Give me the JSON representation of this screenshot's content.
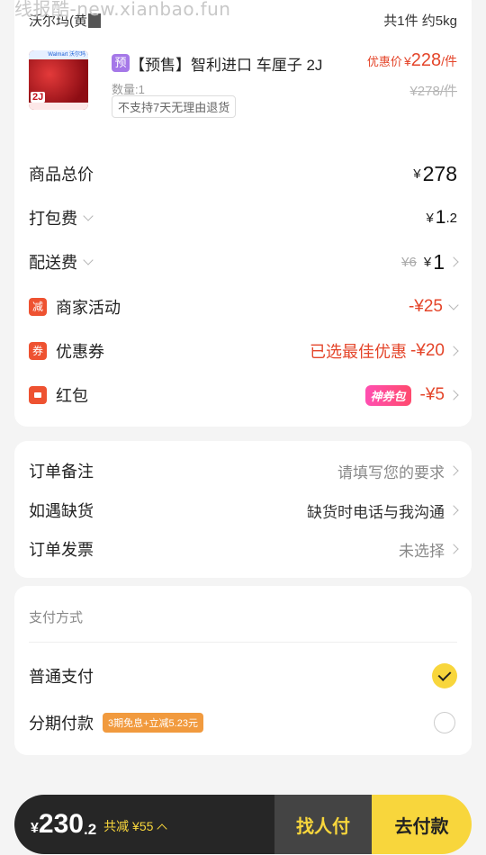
{
  "watermark": "线报酷-new.xianbao.fun",
  "store": {
    "name": "沃尔玛(黄",
    "summary": "共1件 约5kg"
  },
  "product": {
    "thumb_brand": "Walmart 沃尔玛",
    "thumb_badge": "2J",
    "pre_badge": "预",
    "title": "【预售】智利进口 车厘子 2J",
    "qty": "数量:1",
    "return_note": "不支持7天无理由退货",
    "price_label": "优惠价",
    "currency": "¥",
    "price": "228",
    "unit": "/件",
    "original_price": "¥278/件"
  },
  "fees": {
    "total": {
      "label": "商品总价",
      "currency": "¥",
      "value": "278"
    },
    "packing": {
      "label": "打包费",
      "currency": "¥",
      "int": "1",
      "dec": ".2"
    },
    "delivery": {
      "label": "配送费",
      "original": "¥6",
      "currency": "¥",
      "value": "1"
    },
    "merchant": {
      "icon": "减",
      "label": "商家活动",
      "value": "-¥25"
    },
    "coupon": {
      "icon": "券",
      "label": "优惠券",
      "note": "已选最佳优惠",
      "value": "-¥20"
    },
    "redpacket": {
      "label": "红包",
      "badge": "神券包",
      "value": "-¥5"
    }
  },
  "remarks": {
    "note": {
      "label": "订单备注",
      "value": "请填写您的要求"
    },
    "stockout": {
      "label": "如遇缺货",
      "value": "缺货时电话与我沟通"
    },
    "invoice": {
      "label": "订单发票",
      "value": "未选择"
    }
  },
  "payment": {
    "title": "支付方式",
    "normal": {
      "label": "普通支付",
      "selected": true
    },
    "installment": {
      "label": "分期付款",
      "badge": "3期免息+立减5.23元",
      "selected": false
    }
  },
  "bottom": {
    "currency": "¥",
    "total_int": "230",
    "total_dec": ".2",
    "saved": "共减 ¥55",
    "find_payer": "找人付",
    "pay": "去付款"
  },
  "colors": {
    "accent": "#f8d63c",
    "discount": "#e4452a",
    "dark": "#262626",
    "badge_purple": "#a578e8",
    "badge_orange": "#f19a3e"
  }
}
